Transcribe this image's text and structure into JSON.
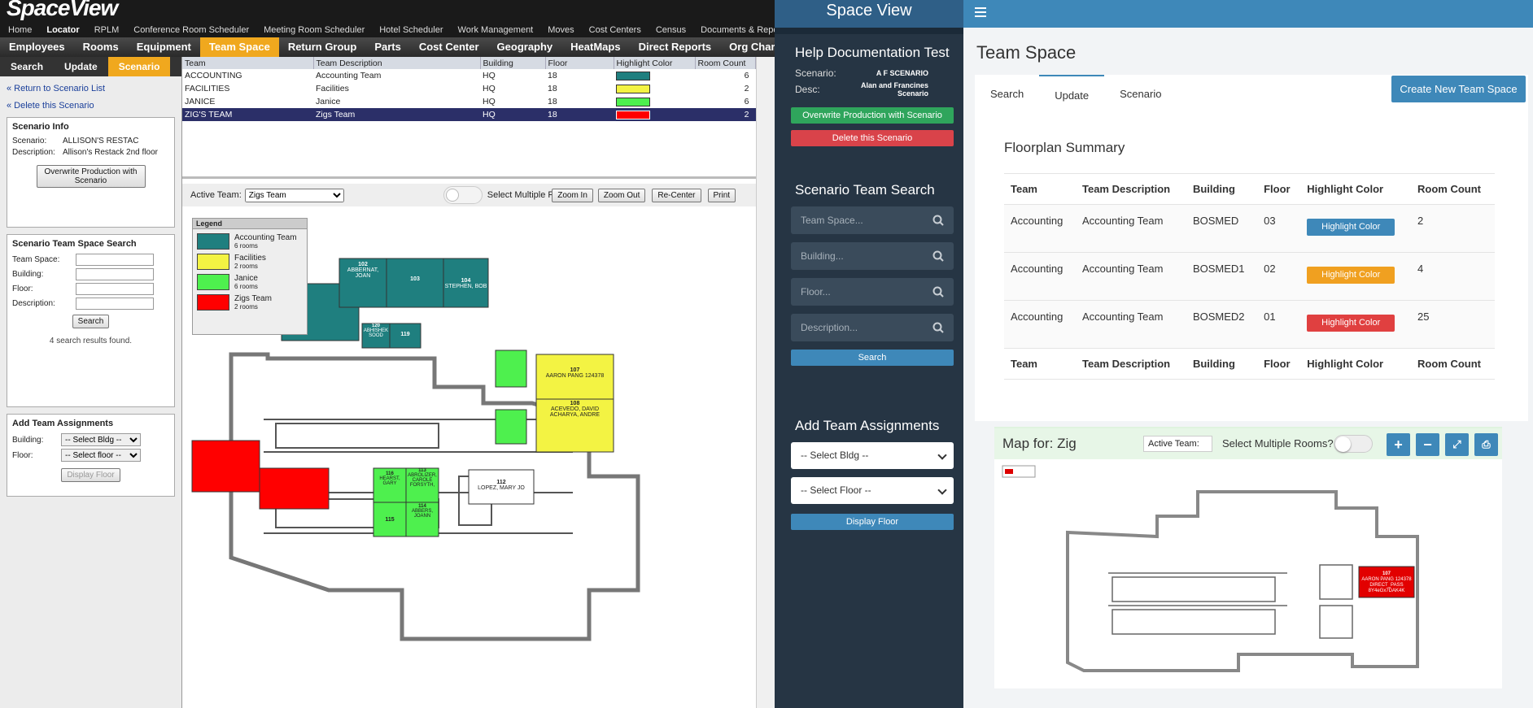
{
  "old_ui": {
    "logo": "SpaceView",
    "top_nav": [
      "Home",
      "Locator",
      "RPLM",
      "Conference Room Scheduler",
      "Meeting Room Scheduler",
      "Hotel Scheduler",
      "Work Management",
      "Moves",
      "Cost Centers",
      "Census",
      "Documents & Reports"
    ],
    "main_nav": [
      "Employees",
      "Rooms",
      "Equipment",
      "Team Space",
      "Return Group",
      "Parts",
      "Cost Center",
      "Geography",
      "HeatMaps",
      "Direct Reports",
      "Org Char"
    ],
    "sub_tabs": [
      "Search",
      "Update",
      "Scenario"
    ],
    "links": {
      "return": "« Return to Scenario List",
      "delete": "« Delete this Scenario"
    },
    "scenario_info": {
      "heading": "Scenario Info",
      "scenario_label": "Scenario:",
      "scenario_value": "ALLISON'S RESTAC",
      "desc_label": "Description:",
      "desc_value": "Allison's Restack 2nd floor",
      "overwrite_btn": "Overwrite Production with Scenario"
    },
    "search_box": {
      "heading": "Scenario Team Space Search",
      "team_label": "Team Space:",
      "building_label": "Building:",
      "floor_label": "Floor:",
      "desc_label": "Description:",
      "search_btn": "Search",
      "results": "4 search results found."
    },
    "assign_box": {
      "heading": "Add Team Assignments",
      "building_label": "Building:",
      "floor_label": "Floor:",
      "bldg_select": "-- Select Bldg --",
      "floor_select": "-- Select floor --",
      "display_btn": "Display Floor"
    },
    "grid": {
      "headers": [
        "Team",
        "Team Description",
        "Building",
        "Floor",
        "Highlight Color",
        "Room Count"
      ],
      "rows": [
        {
          "team": "ACCOUNTING",
          "desc": "Accounting Team",
          "bldg": "HQ",
          "floor": "18",
          "color": "#1f7f7f",
          "count": "6"
        },
        {
          "team": "FACILITIES",
          "desc": "Facilities",
          "bldg": "HQ",
          "floor": "18",
          "color": "#f3f343",
          "count": "2"
        },
        {
          "team": "JANICE",
          "desc": "Janice",
          "bldg": "HQ",
          "floor": "18",
          "color": "#4ef04e",
          "count": "6"
        },
        {
          "team": "ZIG'S TEAM",
          "desc": "Zigs Team",
          "bldg": "HQ",
          "floor": "18",
          "color": "#ff0000",
          "count": "2"
        }
      ]
    },
    "toolbar": {
      "active_label": "Active Team:",
      "active_value": "Zigs Team",
      "multi": "Select Multiple Rooms",
      "zoom_in": "Zoom In",
      "zoom_out": "Zoom Out",
      "recenter": "Re-Center",
      "print": "Print"
    },
    "legend": {
      "title": "Legend",
      "items": [
        {
          "name": "Accounting Team",
          "rooms": "6 rooms",
          "color": "#1f7f7f"
        },
        {
          "name": "Facilities",
          "rooms": "2 rooms",
          "color": "#f3f343"
        },
        {
          "name": "Janice",
          "rooms": "6 rooms",
          "color": "#4ef04e"
        },
        {
          "name": "Zigs Team",
          "rooms": "2 rooms",
          "color": "#ff0000"
        }
      ]
    },
    "rooms": {
      "r102": "102",
      "r102n": "ABBERNAT, JOAN",
      "r103": "103",
      "r104": "104",
      "r104n": "STEPHEN, BOB",
      "r120": "120",
      "r120n": "ABHISHEK SOOD",
      "r119": "119",
      "r107": "107",
      "r107n": "AARON PANG 124378",
      "r108": "108",
      "r108n": "ACEVEDO, DAVID ACHARYA, ANDRE",
      "r116": "116",
      "r116n": "HEARST, GARY",
      "r113": "113",
      "r113n": "ABROLIZER, CAROLE FORSYTH,",
      "r115": "115",
      "r114": "114",
      "r114n": "ABBERS, JOANN",
      "r112": "112",
      "r112n": "LOPEZ, MARY JO"
    }
  },
  "mid_ui": {
    "app_title": "Space View",
    "heading": "Help Documentation Test",
    "scenario_label": "Scenario:",
    "scenario_value": "A F SCENARIO",
    "desc_label": "Desc:",
    "desc_value": "Alan and Francines Scenario",
    "overwrite_btn": "Overwrite Production with Scenario",
    "delete_btn": "Delete this Scenario",
    "search_heading": "Scenario Team Search",
    "placeholders": {
      "team": "Team Space...",
      "building": "Building...",
      "floor": "Floor...",
      "desc": "Description..."
    },
    "search_btn": "Search",
    "assign_heading": "Add Team Assignments",
    "bldg_select": "-- Select Bldg --",
    "floor_select": "-- Select Floor --",
    "display_btn": "Display Floor"
  },
  "right_ui": {
    "title": "Team Space",
    "tabs": [
      "Search",
      "Update",
      "Scenario"
    ],
    "create_btn": "Create New Team Space",
    "summary_title": "Floorplan Summary",
    "headers": [
      "Team",
      "Team Description",
      "Building",
      "Floor",
      "Highlight Color",
      "Room Count"
    ],
    "rows": [
      {
        "team": "Accounting",
        "desc": "Accounting Team",
        "bldg": "BOSMED",
        "floor": "03",
        "btn": "Highlight Color",
        "color": "#3e88b9",
        "count": "2"
      },
      {
        "team": "Accounting",
        "desc": "Accounting Team",
        "bldg": "BOSMED1",
        "floor": "02",
        "btn": "Highlight Color",
        "color": "#f0a020",
        "count": "4"
      },
      {
        "team": "Accounting",
        "desc": "Accounting Team",
        "bldg": "BOSMED2",
        "floor": "01",
        "btn": "Highlight Color",
        "color": "#e04040",
        "count": "25"
      }
    ],
    "map_title": "Map for: Zig",
    "active_team": "Active Team:",
    "multi": "Select Multiple Rooms?",
    "mini_rooms": {
      "r107": "107",
      "r107n": "AARON PANG 124378 DIRECT_PASS 8Y4eGx7DAK4K"
    }
  }
}
